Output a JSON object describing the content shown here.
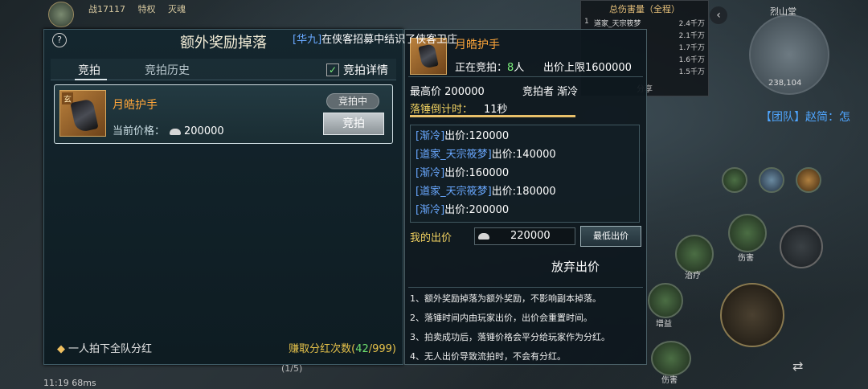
{
  "hud": {
    "power": "战17117",
    "privilege": "特权",
    "extra": "灭魂"
  },
  "damage_board": {
    "title": "总伤害量（全程）",
    "rows": [
      {
        "rank": "1",
        "name": "道家_天宗筱梦",
        "value": "2.4千万"
      },
      {
        "rank": "",
        "name": "",
        "value": "2.1千万"
      },
      {
        "rank": "",
        "name": "",
        "value": "1.7千万"
      },
      {
        "rank": "",
        "name": "",
        "value": "1.6千万"
      },
      {
        "rank": "",
        "name": "",
        "value": "1.5千万"
      }
    ],
    "share": "分享"
  },
  "minimap": {
    "place": "烈山堂",
    "coord": "238,104"
  },
  "team_message": "【团队】赵简：怎",
  "skills": {
    "damage1": "伤害",
    "heal": "治疗",
    "gain": "增益",
    "damage2": "伤害"
  },
  "panel": {
    "title": "额外奖励掉落",
    "help": "?",
    "tabs": {
      "auction": "竞拍",
      "history": "竞拍历史"
    },
    "detail_label": "竞拍详情",
    "detail_checked": "✓",
    "item": {
      "tag": "玄",
      "name": "月皓护手",
      "status": "竞拍中",
      "bid_button": "竞拍",
      "price_label": "当前价格：",
      "price": "200000"
    },
    "footer_left": "一人拍下全队分红",
    "footer_right_label": "赚取分红次数(",
    "footer_right_count": "42",
    "footer_right_total": "/999)"
  },
  "announcement": {
    "prefix": "[华九]",
    "text": "在侠客招募中结识了侠客卫庄"
  },
  "detail": {
    "name": "月皓护手",
    "bidding_label": "正在竞拍：",
    "bidding_count": "8",
    "bidding_unit": "人",
    "limit_label": "出价上限",
    "limit_value": "1600000",
    "high_label": "最高价",
    "high_value": "200000",
    "bidder_label": "竞拍者",
    "bidder_value": "渐冷",
    "count_label": "落锤倒计时：",
    "count_value": "11秒",
    "log": [
      {
        "name": "[渐冷]",
        "text": "出价:120000"
      },
      {
        "name": "[道家_天宗筱梦]",
        "text": "出价:140000"
      },
      {
        "name": "[渐冷]",
        "text": "出价:160000"
      },
      {
        "name": "[道家_天宗筱梦]",
        "text": "出价:180000"
      },
      {
        "name": "[渐冷]",
        "text": "出价:200000"
      }
    ],
    "my_bid_label": "我的出价",
    "my_bid_value": "220000",
    "min_bid_button": "最低出价",
    "give_up": "放弃出价",
    "rules": [
      "1、额外奖励掉落为额外奖励，不影响副本掉落。",
      "2、落锤时间内由玩家出价，出价会重置时间。",
      "3、拍卖成功后，落锤价格会平分给玩家作为分红。",
      "4、无人出价导致流拍时，不会有分红。"
    ]
  },
  "status_bar": "11:19  68ms",
  "chat_hint": "(1/5)"
}
